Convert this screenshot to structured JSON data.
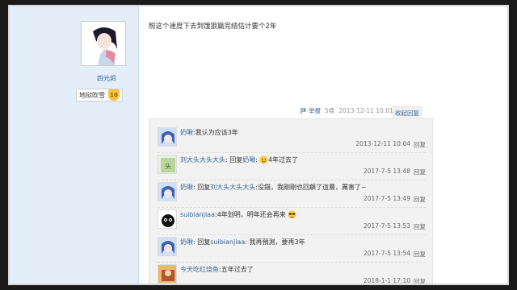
{
  "post": {
    "author": "四元烬",
    "rank_title": "地狱吹雪",
    "rank_level": "10",
    "content": "照这个速度下去到饿狼篇完结估计要个2年",
    "report_label": "举报",
    "floor": "5楼",
    "timestamp": "2013-12-11 10:01",
    "collapse_label": "收起回复"
  },
  "replies": [
    {
      "author": "奶啾",
      "sep": ":",
      "text": " 我认为应该3年",
      "time": "2013-12-11 10:04",
      "reply_label": "回复"
    },
    {
      "author": "刘大头大头大头",
      "sep": ":",
      "prefix": "回复 ",
      "target": "奶啾",
      "target_sep": " :",
      "text": "4年过去了",
      "time": "2017-7-5 13:48",
      "reply_label": "回复"
    },
    {
      "author": "奶啾",
      "sep": ":",
      "prefix": "回复 ",
      "target": "刘大头大头大头",
      "target_sep": " :",
      "text": "没錯，我剛剛也回顧了這層，厲害了~",
      "time": "2017-7-5 13:49",
      "reply_label": "回复"
    },
    {
      "author": "suibianjiaa",
      "sep": ":",
      "text": " 4年划明，明年还会再来",
      "time": "2017-7-5 13:53",
      "reply_label": "回复"
    },
    {
      "author": "奶啾",
      "sep": ":",
      "prefix": "回复 ",
      "target": "suibianjiaa",
      "target_sep": " :",
      "text": "我再預測，要再3年",
      "time": "2017-7-5 13:54",
      "reply_label": "回复"
    },
    {
      "author": "今天吃红烧鱼",
      "sep": ":",
      "text": " 五年过去了",
      "time": "2018-1-1 17:10",
      "reply_label": "回复"
    }
  ],
  "colors": {
    "link": "#336699",
    "sidebar_bg": "#e4eef9",
    "reply_bg": "#f2f2f2"
  },
  "icons": [
    "report-icon",
    "smile-emoji-icon",
    "sunglasses-emoji-icon"
  ]
}
